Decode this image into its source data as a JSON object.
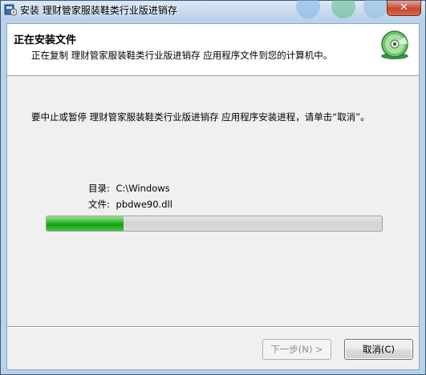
{
  "window": {
    "title": "安装 理财管家服装鞋类行业版进销存",
    "close_glyph": "✕"
  },
  "header": {
    "title": "正在安装文件",
    "subtitle": "正在复制 理财管家服装鞋类行业版进销存 应用程序文件到您的计算机中。",
    "icon": "cd-install-icon"
  },
  "body": {
    "instruction": "要中止或暂停 理财管家服装鞋类行业版进销存 应用程序安装进程，请单击“取消”。",
    "directory_label": "目录:",
    "directory_value": "C:\\Windows",
    "file_label": "文件:",
    "file_value": "pbdwe90.dll"
  },
  "progress": {
    "value_fraction": 0.23,
    "color": "#1aa81a"
  },
  "buttons": {
    "next_label": "下一步(N) >",
    "next_enabled": false,
    "cancel_label": "取消(C)"
  }
}
